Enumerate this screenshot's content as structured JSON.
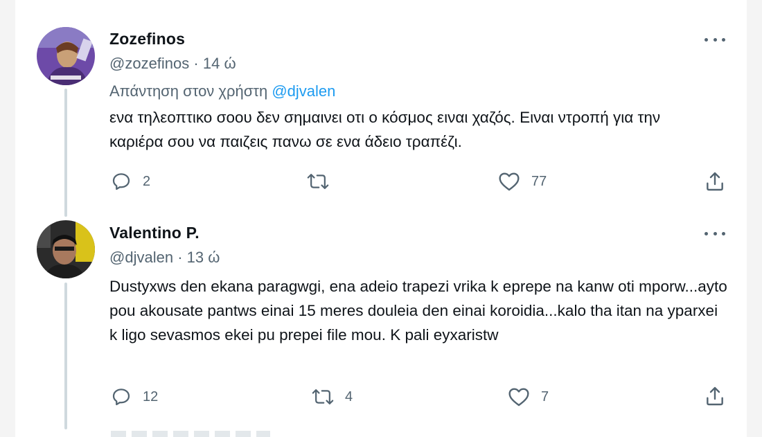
{
  "tweets": [
    {
      "name": "Zozefinos",
      "handle": "@zozefinos",
      "separator": "·",
      "time": "14 ώ",
      "reply_prefix": "Απάντηση στον χρήστη",
      "reply_mention": "@djvalen",
      "text": "ενα τηλεοπτικο σοου δεν σημαινει οτι ο κόσμος ειναι χαζός. Ειναι ντροπή για την καριέρα σου να παιζεις πανω σε ενα άδειο τραπέζι.",
      "replies": "2",
      "retweets": "",
      "likes": "77",
      "avatar_colors": {
        "bg": "#6d4aa8",
        "accent": "#c9a077"
      }
    },
    {
      "name": "Valentino P.",
      "handle": "@djvalen",
      "separator": "·",
      "time": "13 ώ",
      "text": "Dustyxws den ekana paragwgi, ena adeio trapezi vrika k eprepe na kanw oti mporw...ayto pou akousate pantws einai 15 meres douleia den einai koroidia...kalo tha itan na yparxei k ligo sevasmos ekei pu prepei file mou. K pali eyxaristw",
      "replies": "12",
      "retweets": "4",
      "likes": "7",
      "avatar_colors": {
        "bg": "#2b2b2b",
        "accent": "#d9c21a"
      }
    }
  ],
  "icons": [
    "reply-icon",
    "retweet-icon",
    "like-icon",
    "share-icon",
    "more-icon"
  ],
  "colors": {
    "text": "#0f1419",
    "muted": "#536471",
    "link": "#1d9bf0",
    "line": "#cfd9de"
  }
}
